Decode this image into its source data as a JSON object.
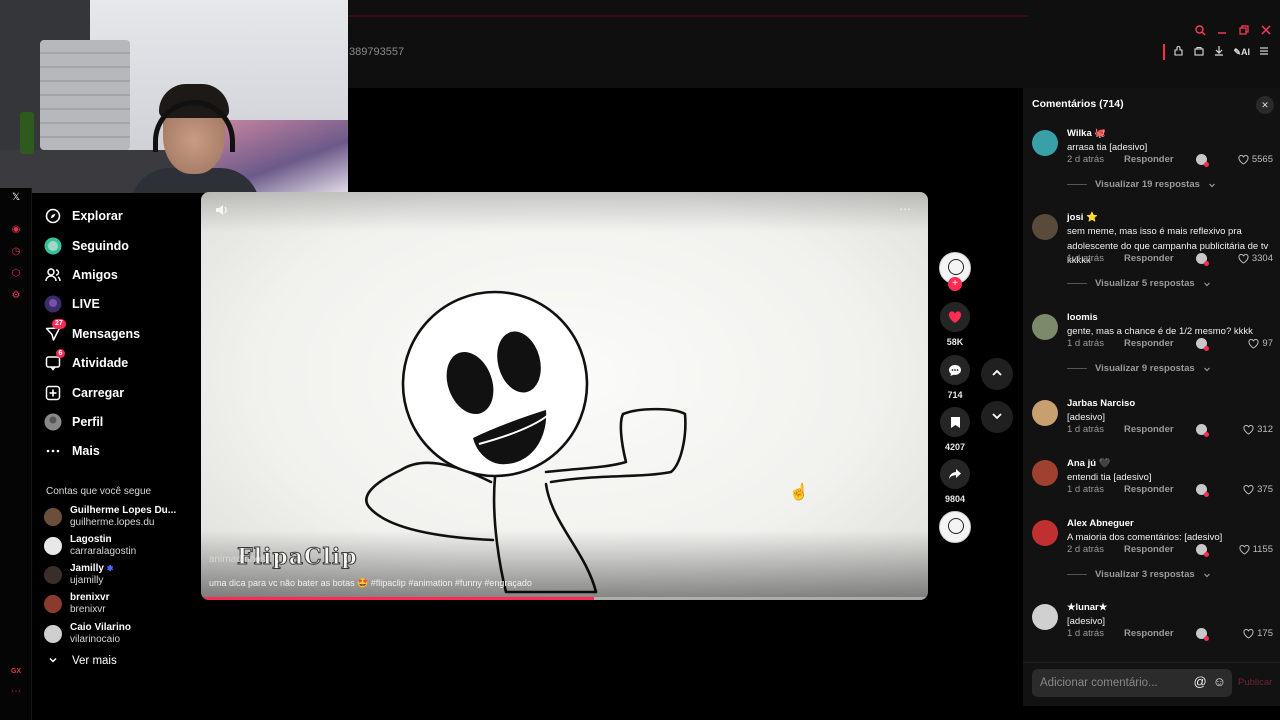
{
  "topbar": {
    "url_fragment": "389793557"
  },
  "sidebar": {
    "nav": [
      {
        "label": "Explorar",
        "badge": ""
      },
      {
        "label": "Seguindo",
        "badge": ""
      },
      {
        "label": "Amigos",
        "badge": ""
      },
      {
        "label": "LIVE",
        "badge": ""
      },
      {
        "label": "Mensagens",
        "badge": "27"
      },
      {
        "label": "Atividade",
        "badge": "6"
      },
      {
        "label": "Carregar",
        "badge": ""
      },
      {
        "label": "Perfil",
        "badge": ""
      },
      {
        "label": "Mais",
        "badge": ""
      }
    ],
    "following_title": "Contas que você segue",
    "following": [
      {
        "name": "Guilherme Lopes Du...",
        "handle": "guilherme.lopes.du",
        "color": "#6b4f3a"
      },
      {
        "name": "Lagostin",
        "handle": "carraralagostin",
        "color": "#e8e8e8"
      },
      {
        "name": "Jamilly",
        "handle": "ujamilly",
        "color": "#3a2d2a"
      },
      {
        "name": "brenixvr",
        "handle": "brenixvr",
        "color": "#8a3b2e"
      },
      {
        "name": "Caio Vilarino",
        "handle": "vilarinocaio",
        "color": "#cfcfcf"
      }
    ],
    "see_more": "Ver mais",
    "rail_bottom": "GX"
  },
  "video": {
    "watermark": "FlipaClip",
    "author": "animadinhos",
    "caption": "uma dica para vc não bater as botas 🤩 #flipaclip #animation #funny #engraçado",
    "progress_fraction": 0.54
  },
  "actions": {
    "likes": "58K",
    "comments": "714",
    "saves": "4207",
    "shares": "9804"
  },
  "comments": {
    "title": "Comentários (714)",
    "reply_label": "Responder",
    "items": [
      {
        "user": "Wilka 🐙",
        "text": "arrasa tia [adesivo]",
        "time": "2 d atrás",
        "likes": "5565",
        "replies": "Visualizar 19 respostas",
        "color": "#3aa0a8"
      },
      {
        "user": "josi ⭐",
        "text": "sem meme, mas isso é mais reflexivo pra adolescente do que campanha publicitária de tv kkkkk",
        "time": "1 d atrás",
        "likes": "3304",
        "replies": "Visualizar 5 respostas",
        "color": "#5a4a3c"
      },
      {
        "user": "loomis",
        "text": "gente, mas a chance é de 1/2 mesmo? kkkk",
        "time": "1 d atrás",
        "likes": "97",
        "replies": "Visualizar 9 respostas",
        "color": "#7a8a6a"
      },
      {
        "user": "Jarbas Narciso",
        "text": " [adesivo]",
        "time": "1 d atrás",
        "likes": "312",
        "replies": "",
        "color": "#c8a070"
      },
      {
        "user": "Ana jú 🖤",
        "text": "entendi tia [adesivo]",
        "time": "1 d atrás",
        "likes": "375",
        "replies": "",
        "color": "#a04030"
      },
      {
        "user": "Alex Abneguer",
        "text": "A maioria dos comentários: [adesivo]",
        "time": "2 d atrás",
        "likes": "1155",
        "replies": "Visualizar 3 respostas",
        "color": "#c03030"
      },
      {
        "user": "★lunar★",
        "text": " [adesivo]",
        "time": "1 d atrás",
        "likes": "175",
        "replies": "",
        "color": "#d0d0d0"
      }
    ],
    "input_placeholder": "Adicionar comentário...",
    "publish_label": "Publicar"
  }
}
